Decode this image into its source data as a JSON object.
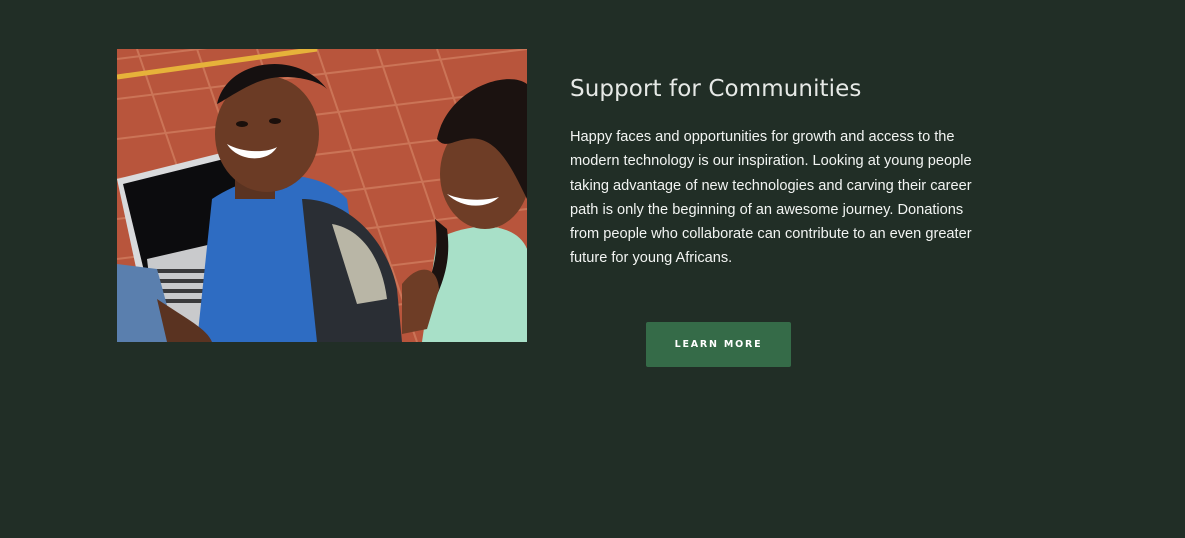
{
  "section": {
    "title": "Support for Communities",
    "body": "Happy faces and  opportunities for growth and access to the modern technology is our inspiration. Looking at young people taking advantage of new technologies and carving their career path is only the beginning of an awesome journey. Donations from people who collaborate can contribute to an even greater future for young Africans.",
    "button_label": "LEARN MORE"
  },
  "colors": {
    "background": "#212e26",
    "button": "#356b48",
    "title_text": "#e6e9e6",
    "body_text": "#f2f4f2"
  }
}
